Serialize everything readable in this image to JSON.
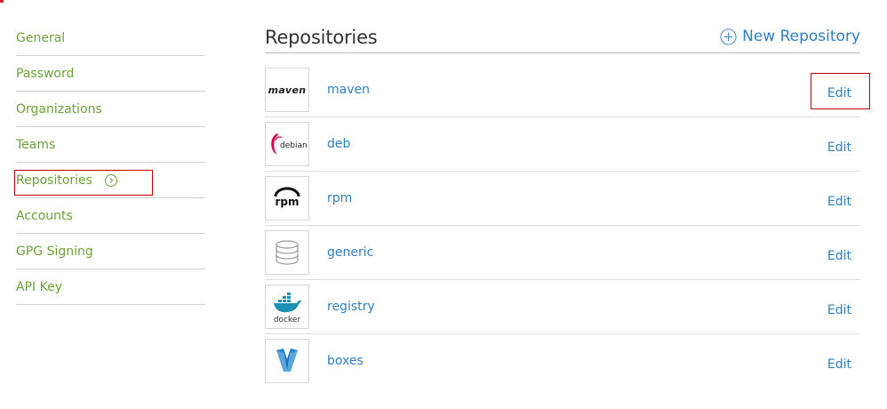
{
  "sidebar": {
    "items": [
      {
        "label": "General"
      },
      {
        "label": "Password"
      },
      {
        "label": "Organizations"
      },
      {
        "label": "Teams"
      },
      {
        "label": "Repositories",
        "active": true
      },
      {
        "label": "Accounts"
      },
      {
        "label": "GPG Signing"
      },
      {
        "label": "API Key"
      }
    ]
  },
  "header": {
    "title": "Repositories",
    "new_repo_label": "New Repository"
  },
  "repositories": [
    {
      "name": "maven",
      "logo": "maven-logo",
      "logo_text": "maven",
      "edit_label": "Edit"
    },
    {
      "name": "deb",
      "logo": "debian-logo",
      "logo_text": "debian",
      "edit_label": "Edit"
    },
    {
      "name": "rpm",
      "logo": "rpm-logo",
      "logo_text": "rpm",
      "edit_label": "Edit"
    },
    {
      "name": "generic",
      "logo": "database-icon",
      "edit_label": "Edit"
    },
    {
      "name": "registry",
      "logo": "docker-logo",
      "logo_text": "docker",
      "edit_label": "Edit"
    },
    {
      "name": "boxes",
      "logo": "vagrant-logo",
      "edit_label": "Edit"
    }
  ],
  "colors": {
    "sidebar_text": "#6aa336",
    "link": "#2f7fc4",
    "highlight": "#c00000"
  }
}
